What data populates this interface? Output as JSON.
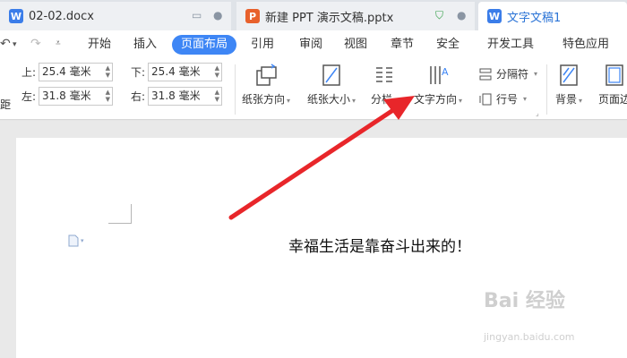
{
  "tabs": [
    {
      "title": "02-02.docx",
      "icon": "W",
      "icon_color": "#3b7de9"
    },
    {
      "title": "新建 PPT 演示文稿.pptx",
      "icon": "P",
      "icon_color": "#e8612c"
    },
    {
      "title": "文字文稿1",
      "icon": "W",
      "icon_color": "#3b7de9"
    }
  ],
  "menu": {
    "items": [
      "开始",
      "插入",
      "页面布局",
      "引用",
      "审阅",
      "视图",
      "章节",
      "安全",
      "开发工具",
      "特色应用"
    ],
    "active": "页面布局"
  },
  "margins": {
    "top_label": "上:",
    "top_value": "25.4 毫米",
    "bottom_label": "下:",
    "bottom_value": "25.4 毫米",
    "left_label": "左:",
    "left_value": "31.8 毫米",
    "right_label": "右:",
    "right_value": "31.8 毫米",
    "cut_label": "距"
  },
  "tools": {
    "orientation": "纸张方向",
    "size": "纸张大小",
    "columns": "分栏",
    "text_direction": "文字方向",
    "separator": "分隔符",
    "line_number": "行号",
    "background": "背景",
    "page_border": "页面边"
  },
  "document": {
    "text": "幸福生活是靠奋斗出来的！"
  },
  "watermark": {
    "main": "Bai 经验",
    "sub": "jingyan.baidu.com"
  },
  "colors": {
    "accent": "#3e86f5",
    "arrow": "#e8262a"
  }
}
